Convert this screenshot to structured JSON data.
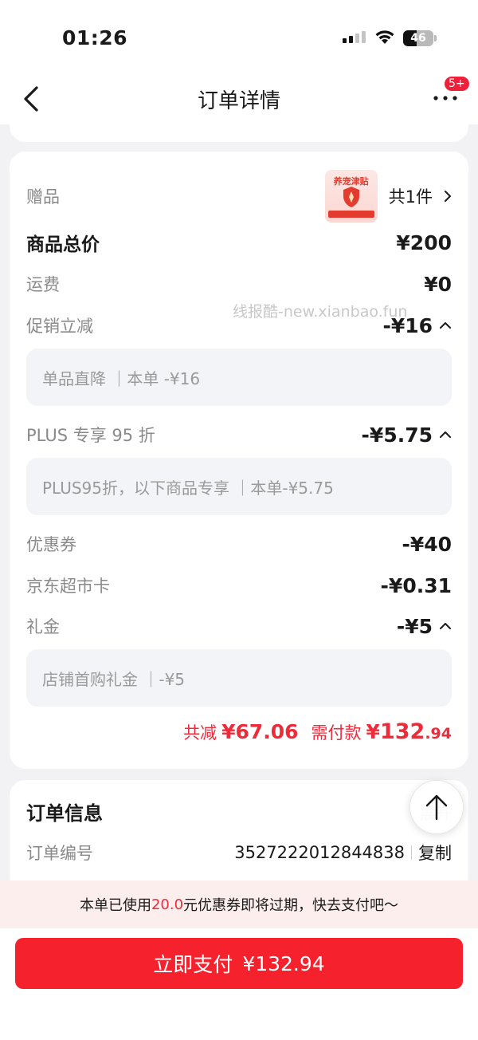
{
  "status_bar": {
    "time": "01:26",
    "battery_level": "46",
    "battery_fraction": 0.46
  },
  "nav": {
    "title": "订单详情",
    "more_badge": "5+"
  },
  "watermark": "线报酷-new.xianbao.fun",
  "gift": {
    "label": "赠品",
    "thumb_title": "养宠津贴",
    "count_text": "共1件"
  },
  "prices": {
    "total": {
      "label": "商品总价",
      "value": "¥200"
    },
    "shipping": {
      "label": "运费",
      "value": "¥0"
    },
    "promo": {
      "label": "促销立减",
      "value": "-¥16",
      "detail": "单品直降 ｜本单 -¥16"
    },
    "plus": {
      "label": "PLUS 专享 95 折",
      "value": "-¥5.75",
      "detail": "PLUS95折，以下商品专享 ｜本单-¥5.75"
    },
    "coupon": {
      "label": "优惠券",
      "value": "-¥40"
    },
    "jd_card": {
      "label": "京东超市卡",
      "value": "-¥0.31"
    },
    "gift_money": {
      "label": "礼金",
      "value": "-¥5",
      "detail": "店铺首购礼金 ｜-¥5"
    }
  },
  "summary": {
    "reduced_label": "共减",
    "reduced_value": "¥67.06",
    "pay_label": "需付款",
    "pay_currency": "¥",
    "pay_int": "132",
    "pay_dec": ".94"
  },
  "order_info": {
    "title": "订单信息",
    "expand_label": "展开",
    "number_label": "订单编号",
    "number_value": "3527222012844838",
    "copy_label": "复制"
  },
  "notice": {
    "prefix": "本单已使用",
    "amount": "20.0",
    "suffix": "元优惠券即将过期，快去支付吧～"
  },
  "pay_button": {
    "label": "立即支付",
    "amount": "¥132.94"
  },
  "colors": {
    "accent_red": "#f5222d",
    "price_red": "#ef2b3a",
    "notice_bg": "#fdeeee"
  }
}
